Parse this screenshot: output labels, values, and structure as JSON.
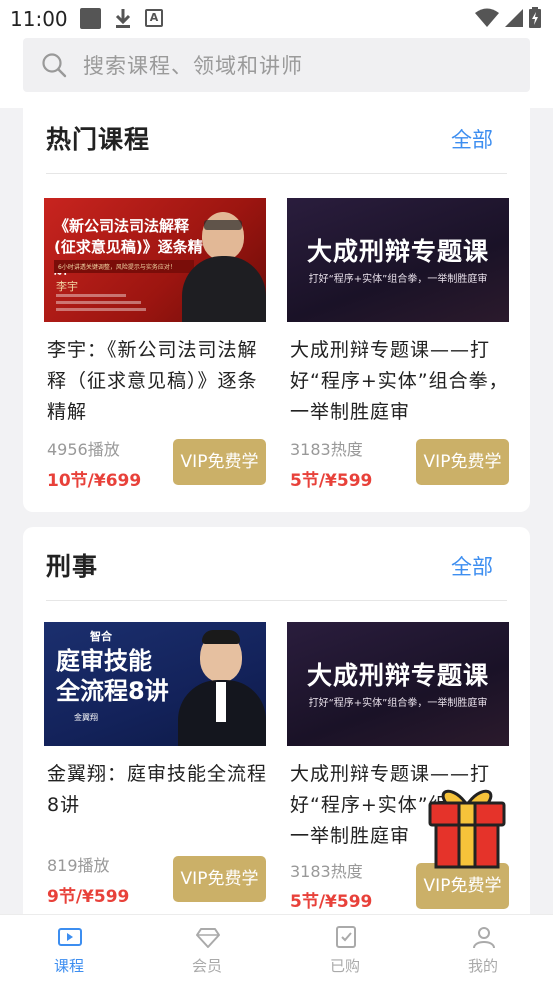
{
  "status": {
    "time": "11:00"
  },
  "search": {
    "placeholder": "搜索课程、领域和讲师"
  },
  "sections": [
    {
      "title": "热门课程",
      "all_label": "全部",
      "courses": [
        {
          "thumb_lines": [
            "《新公司法司法解释",
            "(征求意见稿)》逐条精解"
          ],
          "thumb_sub": "6小时讲透关键调整，风险提示与实务应对！",
          "thumb_name": "李宇",
          "title": "李宇：《新公司法司法解释（征求意见稿）》逐条精解",
          "meta": "4956播放",
          "price": "10节/¥699",
          "button": "VIP免费学"
        },
        {
          "thumb_lines": [
            "大成刑辩专题课"
          ],
          "thumb_sub": "打好“程序+实体”组合拳，一举制胜庭审",
          "title": "大成刑辩专题课——打好“程序+实体”组合拳，一举制胜庭审",
          "meta": "3183热度",
          "price": "5节/¥599",
          "button": "VIP免费学"
        }
      ]
    },
    {
      "title": "刑事",
      "all_label": "全部",
      "courses": [
        {
          "thumb_brand": "智合",
          "thumb_lines": [
            "庭审技能",
            "全流程8讲"
          ],
          "thumb_name": "金翼翔",
          "title": "金翼翔：庭审技能全流程8讲",
          "meta": "819播放",
          "price": "9节/¥599",
          "button": "VIP免费学"
        },
        {
          "thumb_lines": [
            "大成刑辩专题课"
          ],
          "thumb_sub": "打好“程序+实体”组合拳，一举制胜庭审",
          "title": "大成刑辩专题课——打好“程序+实体”组合拳，一举制胜庭审",
          "meta": "3183热度",
          "price": "5节/¥599",
          "button": "VIP免费学"
        }
      ]
    }
  ],
  "tabs": [
    {
      "label": "课程",
      "icon": "video-icon",
      "active": true
    },
    {
      "label": "会员",
      "icon": "diamond-icon",
      "active": false
    },
    {
      "label": "已购",
      "icon": "purchased-icon",
      "active": false
    },
    {
      "label": "我的",
      "icon": "user-icon",
      "active": false
    }
  ],
  "colors": {
    "accent": "#3d8ef0",
    "price": "#e8413a",
    "vip_button": "#cbb068"
  }
}
